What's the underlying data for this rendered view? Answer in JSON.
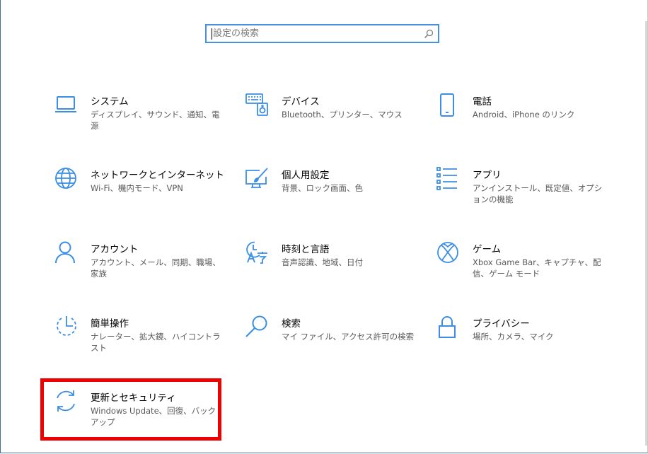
{
  "search": {
    "placeholder": "設定の検索"
  },
  "tiles": [
    {
      "title": "システム",
      "desc": "ディスプレイ、サウンド、通知、電源"
    },
    {
      "title": "デバイス",
      "desc": "Bluetooth、プリンター、マウス"
    },
    {
      "title": "電話",
      "desc": "Android、iPhone のリンク"
    },
    {
      "title": "ネットワークとインターネット",
      "desc": "Wi-Fi、機内モード、VPN"
    },
    {
      "title": "個人用設定",
      "desc": "背景、ロック画面、色"
    },
    {
      "title": "アプリ",
      "desc": "アンインストール、既定値、オプションの機能"
    },
    {
      "title": "アカウント",
      "desc": "アカウント、メール、同期、職場、家族"
    },
    {
      "title": "時刻と言語",
      "desc": "音声認識、地域、日付"
    },
    {
      "title": "ゲーム",
      "desc": "Xbox Game Bar、キャプチャ、配信、ゲーム モード"
    },
    {
      "title": "簡単操作",
      "desc": "ナレーター、拡大鏡、ハイコントラスト"
    },
    {
      "title": "検索",
      "desc": "マイ ファイル、アクセス許可の検索"
    },
    {
      "title": "プライバシー",
      "desc": "場所、カメラ、マイク"
    },
    {
      "title": "更新とセキュリティ",
      "desc": "Windows Update、回復、バックアップ"
    }
  ],
  "colors": {
    "accent": "#3a8ee6",
    "highlight": "#ee0000",
    "search_border": "#4a90e2"
  }
}
